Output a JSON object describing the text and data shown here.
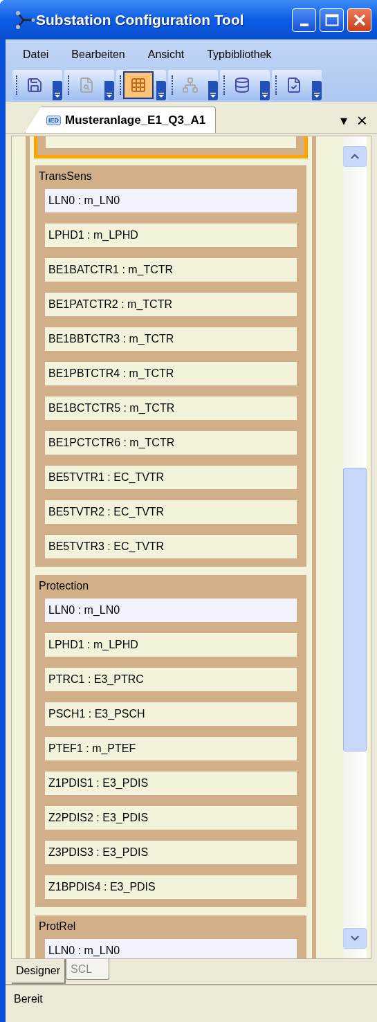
{
  "window": {
    "title": "Substation Configuration Tool"
  },
  "menu": [
    "Datei",
    "Bearbeiten",
    "Ansicht",
    "Typbibliothek"
  ],
  "toolbar": [
    {
      "kind": "save",
      "pressed": false,
      "disabled": false
    },
    {
      "kind": "preview",
      "pressed": false,
      "disabled": true
    },
    {
      "kind": "grid",
      "pressed": true,
      "disabled": false
    },
    {
      "kind": "hierarchy",
      "pressed": false,
      "disabled": true
    },
    {
      "kind": "database",
      "pressed": false,
      "disabled": false
    },
    {
      "kind": "check",
      "pressed": false,
      "disabled": false
    }
  ],
  "document_tab": {
    "badge": "IED",
    "title": "Musteranlage_E1_Q3_A1",
    "menu_glyph": "▾",
    "close_glyph": "×"
  },
  "groups": [
    {
      "selected": true
    },
    {
      "selected": false,
      "title": "TransSens",
      "items": [
        {
          "kind": "ln0",
          "label": "LLN0 : m_LN0"
        },
        {
          "kind": "ln",
          "label": "LPHD1 : m_LPHD"
        },
        {
          "kind": "ln",
          "label": "BE1BATCTR1 : m_TCTR"
        },
        {
          "kind": "ln",
          "label": "BE1PATCTR2 : m_TCTR"
        },
        {
          "kind": "ln",
          "label": "BE1BBTCTR3 : m_TCTR"
        },
        {
          "kind": "ln",
          "label": "BE1PBTCTR4 : m_TCTR"
        },
        {
          "kind": "ln",
          "label": "BE1BCTCTR5 : m_TCTR"
        },
        {
          "kind": "ln",
          "label": "BE1PCTCTR6 : m_TCTR"
        },
        {
          "kind": "ln",
          "label": "BE5TVTR1 : EC_TVTR"
        },
        {
          "kind": "ln",
          "label": "BE5TVTR2 : EC_TVTR"
        },
        {
          "kind": "ln",
          "label": "BE5TVTR3 : EC_TVTR"
        }
      ]
    },
    {
      "selected": false,
      "title": "Protection",
      "items": [
        {
          "kind": "ln0",
          "label": "LLN0 : m_LN0"
        },
        {
          "kind": "ln",
          "label": "LPHD1 : m_LPHD"
        },
        {
          "kind": "ln",
          "label": "PTRC1 : E3_PTRC"
        },
        {
          "kind": "ln",
          "label": "PSCH1 : E3_PSCH"
        },
        {
          "kind": "ln",
          "label": "PTEF1 : m_PTEF"
        },
        {
          "kind": "ln",
          "label": "Z1PDIS1 : E3_PDIS"
        },
        {
          "kind": "ln",
          "label": "Z2PDIS2 : E3_PDIS"
        },
        {
          "kind": "ln",
          "label": "Z3PDIS3 : E3_PDIS"
        },
        {
          "kind": "ln",
          "label": "Z1BPDIS4 : E3_PDIS"
        }
      ]
    },
    {
      "selected": false,
      "title": "ProtRel",
      "items": [
        {
          "kind": "ln0",
          "label": "LLN0 : m_LN0"
        }
      ]
    }
  ],
  "view_tabs": [
    {
      "label": "Designer",
      "selected": true
    },
    {
      "label": "SCL",
      "selected": false
    }
  ],
  "status_bar": {
    "text": "Bereit"
  }
}
